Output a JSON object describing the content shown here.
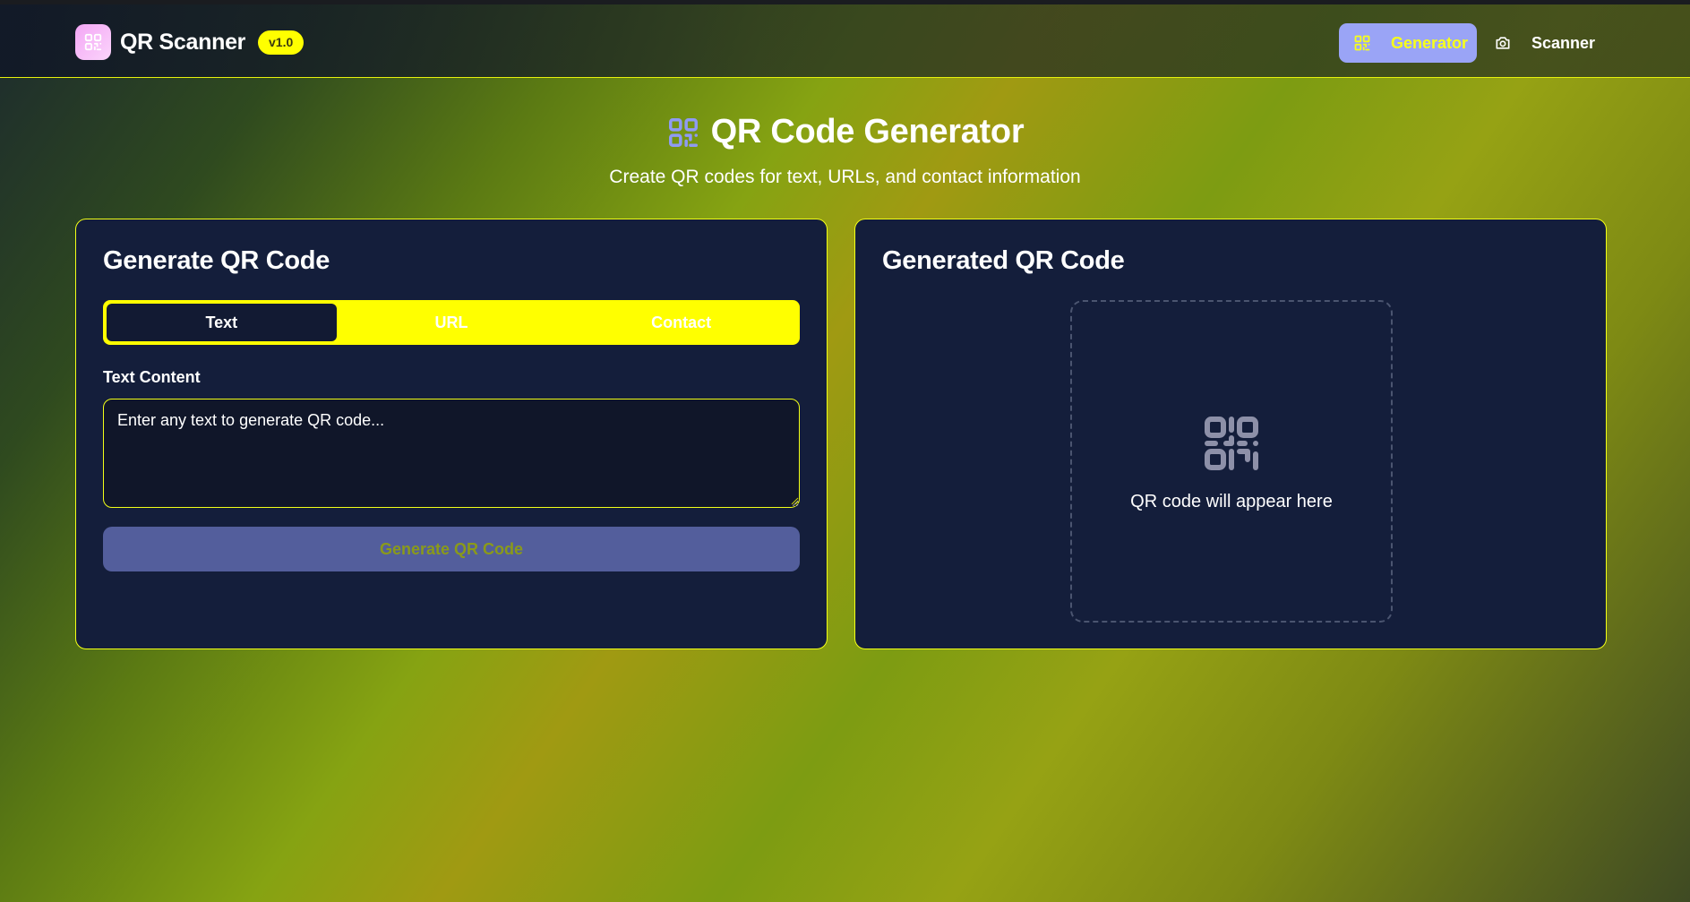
{
  "app": {
    "title": "QR Scanner",
    "version": "v1.0"
  },
  "nav": {
    "generator_label": "Generator",
    "scanner_label": "Scanner",
    "active": "Generator"
  },
  "hero": {
    "title": "QR Code Generator",
    "subtitle": "Create QR codes for text, URLs, and contact information"
  },
  "generate_card": {
    "title": "Generate QR Code",
    "tabs": [
      {
        "label": "Text",
        "active": true
      },
      {
        "label": "URL",
        "active": false
      },
      {
        "label": "Contact",
        "active": false
      }
    ],
    "field_label": "Text Content",
    "textarea_placeholder": "Enter any text to generate QR code...",
    "textarea_value": "",
    "button_label": "Generate QR Code"
  },
  "result_card": {
    "title": "Generated QR Code",
    "placeholder_text": "QR code will appear here"
  },
  "icons": {
    "logo": "qr-code-icon",
    "generator_nav": "qr-code-icon",
    "scanner_nav": "camera-icon",
    "hero": "qr-code-icon",
    "placeholder": "qr-code-icon"
  },
  "colors": {
    "accent_yellow": "#ffff00",
    "card_bg": "#141e3b",
    "nav_active_bg": "#9aa4f6",
    "logo_pink": "#f3a6f5",
    "button_disabled_bg": "#535e9c"
  }
}
